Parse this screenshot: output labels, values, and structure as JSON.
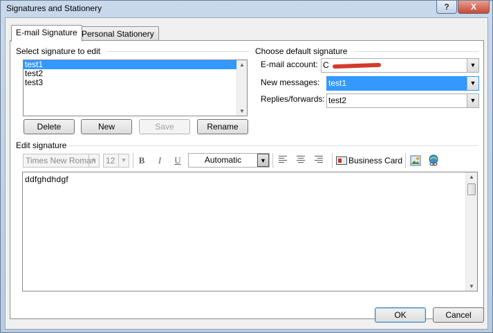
{
  "window": {
    "title": "Signatures and Stationery"
  },
  "title_buttons": {
    "help": "?",
    "close": "X"
  },
  "tabs": [
    {
      "label": "E-mail Signature"
    },
    {
      "label": "Personal Stationery"
    }
  ],
  "select_signature": {
    "heading": "Select signature to edit",
    "items": [
      "test1",
      "test2",
      "test3"
    ],
    "selected": "test1",
    "buttons": {
      "delete": "Delete",
      "new": "New",
      "save": "Save",
      "rename": "Rename"
    }
  },
  "default_signature": {
    "heading": "Choose default signature",
    "email_account_label": "E-mail account:",
    "email_account_value": "C",
    "new_messages_label": "New messages:",
    "new_messages_value": "test1",
    "replies_label": "Replies/forwards:",
    "replies_value": "test2"
  },
  "edit_signature": {
    "heading": "Edit signature",
    "font_name": "Times New Roman",
    "font_size": "12",
    "bold": "B",
    "italic": "I",
    "underline": "U",
    "color": "Automatic",
    "business_card": "Business Card",
    "body_text": "ddfghdhdgf"
  },
  "footer": {
    "ok": "OK",
    "cancel": "Cancel"
  },
  "colors": {
    "selection": "#3399ff",
    "redaction": "#d23b2b"
  }
}
